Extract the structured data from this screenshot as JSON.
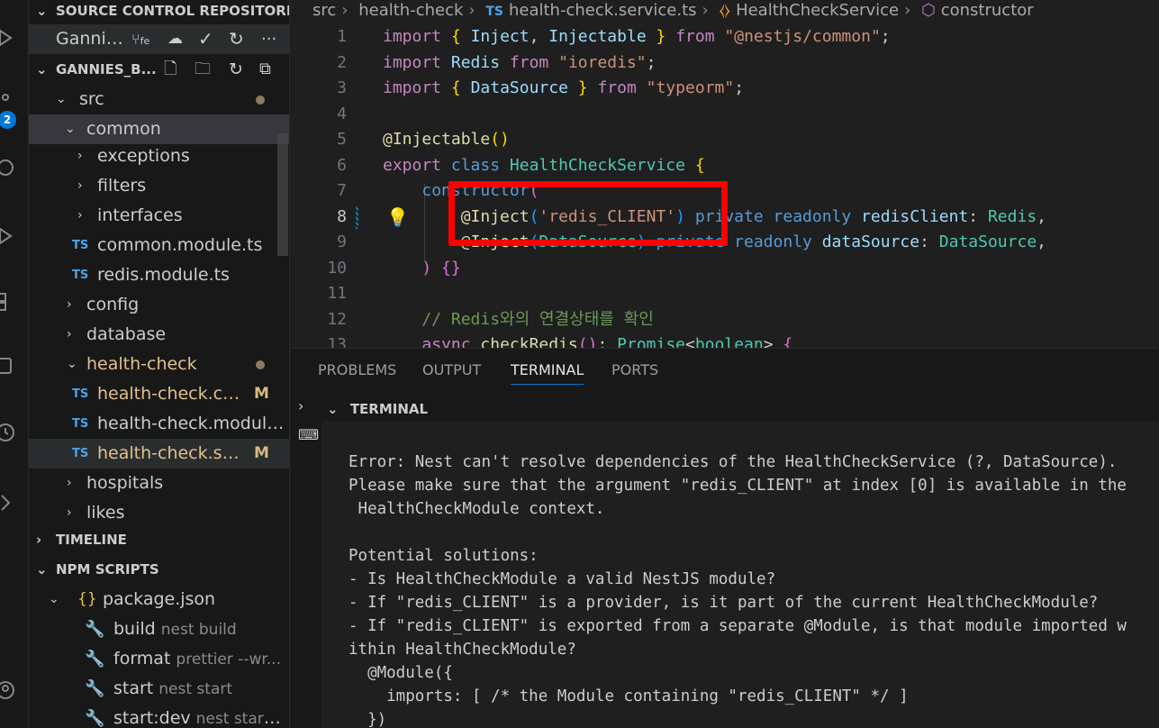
{
  "sidebar": {
    "repo_section": "SOURCE CONTROL REPOSITORI...",
    "repo_name": "Gannie...",
    "repo_branch_icon": "fe",
    "explorer_section": "GANNIES_B...",
    "tree": [
      {
        "label": "src",
        "chev": "v"
      },
      {
        "label": "common",
        "chev": "v"
      },
      {
        "label": "exceptions",
        "chev": ">"
      },
      {
        "label": "filters",
        "chev": ">"
      },
      {
        "label": "interfaces",
        "chev": ">"
      },
      {
        "label": "common.module.ts",
        "ts": "TS"
      },
      {
        "label": "redis.module.ts",
        "ts": "TS"
      },
      {
        "label": "config",
        "chev": ">"
      },
      {
        "label": "database",
        "chev": ">"
      },
      {
        "label": "health-check",
        "chev": "v"
      },
      {
        "label": "health-check.con...",
        "ts": "TS",
        "flag": "M"
      },
      {
        "label": "health-check.module.ts",
        "ts": "TS"
      },
      {
        "label": "health-check.serv...",
        "ts": "TS",
        "flag": "M"
      },
      {
        "label": "hospitals",
        "chev": ">"
      },
      {
        "label": "likes",
        "chev": ">"
      }
    ],
    "timeline_section": "TIMELINE",
    "npm_section": "NPM SCRIPTS",
    "npm_package": "package.json",
    "npm_scripts": [
      {
        "name": "build",
        "cmd": "nest build"
      },
      {
        "name": "format",
        "cmd": "prettier --wr..."
      },
      {
        "name": "start",
        "cmd": "nest start"
      },
      {
        "name": "start:dev",
        "cmd": "nest start ..."
      }
    ]
  },
  "activity": {
    "badge_count": "2"
  },
  "breadcrumb": {
    "parts": [
      "src",
      "health-check"
    ],
    "file": "health-check.service.ts",
    "file_badge": "TS",
    "symbol_class": "HealthCheckService",
    "symbol_method": "constructor"
  },
  "editor": {
    "line_numbers": [
      "1",
      "2",
      "3",
      "4",
      "5",
      "6",
      "7",
      "8",
      "9",
      "10",
      "11",
      "12",
      "13"
    ],
    "active_line": "8"
  },
  "panel": {
    "tabs": [
      "PROBLEMS",
      "OUTPUT",
      "TERMINAL",
      "PORTS"
    ],
    "active_tab": "TERMINAL",
    "terminal_title": "TERMINAL",
    "lines": [
      "Error: Nest can't resolve dependencies of the HealthCheckService (?, DataSource). ",
      "Please make sure that the argument \"redis_CLIENT\" at index [0] is available in the",
      " HealthCheckModule context.",
      "",
      "Potential solutions:",
      "- Is HealthCheckModule a valid NestJS module?",
      "- If \"redis_CLIENT\" is a provider, is it part of the current HealthCheckModule?",
      "- If \"redis_CLIENT\" is exported from a separate @Module, is that module imported w",
      "ithin HealthCheckModule?",
      "  @Module({",
      "    imports: [ /* the Module containing \"redis_CLIENT\" */ ]",
      "  })"
    ]
  },
  "colors": {
    "accent": "#0078d4",
    "annotation_box": "#ff0000",
    "modified": "#e2c08d"
  }
}
